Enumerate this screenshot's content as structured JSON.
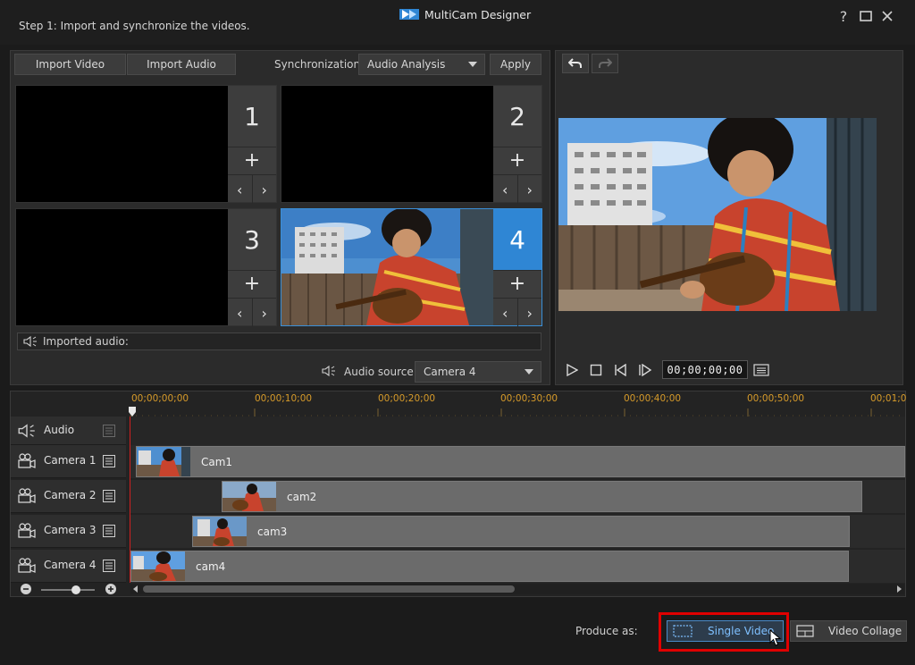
{
  "window": {
    "app_title": "MultiCam Designer",
    "step_label": "Step 1: Import and synchronize the videos.",
    "help_glyph": "?"
  },
  "import_panel": {
    "import_video_label": "Import Video",
    "import_audio_label": "Import Audio",
    "sync_label": "Synchronization:",
    "sync_value": "Audio Analysis",
    "apply_label": "Apply",
    "slots": [
      {
        "number": "1",
        "has_video": false,
        "active": false
      },
      {
        "number": "2",
        "has_video": false,
        "active": false
      },
      {
        "number": "3",
        "has_video": false,
        "active": false
      },
      {
        "number": "4",
        "has_video": true,
        "active": true
      }
    ],
    "imported_audio_label": "Imported audio:",
    "audio_source_label": "Audio source:",
    "audio_source_value": "Camera 4"
  },
  "preview_panel": {
    "timecode": "00;00;00;00",
    "icons": [
      "undo-icon",
      "redo-icon",
      "play-icon",
      "stop-icon",
      "prev-frame-icon",
      "next-frame-icon",
      "timecode-list-icon"
    ]
  },
  "timeline": {
    "ruler_labels": [
      "00;00;00;00",
      "00;00;10;00",
      "00;00;20;00",
      "00;00;30;00",
      "00;00;40;00",
      "00;00;50;00",
      "00;01;0"
    ],
    "tracks": [
      {
        "name": "Audio",
        "type": "audio",
        "clip": null
      },
      {
        "name": "Camera 1",
        "type": "video",
        "clip": "Cam1"
      },
      {
        "name": "Camera 2",
        "type": "video",
        "clip": "cam2"
      },
      {
        "name": "Camera 3",
        "type": "video",
        "clip": "cam3"
      },
      {
        "name": "Camera 4",
        "type": "video",
        "clip": "cam4"
      }
    ]
  },
  "footer": {
    "produce_label": "Produce as:",
    "single_video_label": "Single Video",
    "video_collage_label": "Video Collage"
  },
  "colors": {
    "accent_blue": "#2f86d4",
    "ruler_orange": "#d79b2a",
    "highlight_red": "#e00000",
    "playhead_red": "#d02020"
  }
}
